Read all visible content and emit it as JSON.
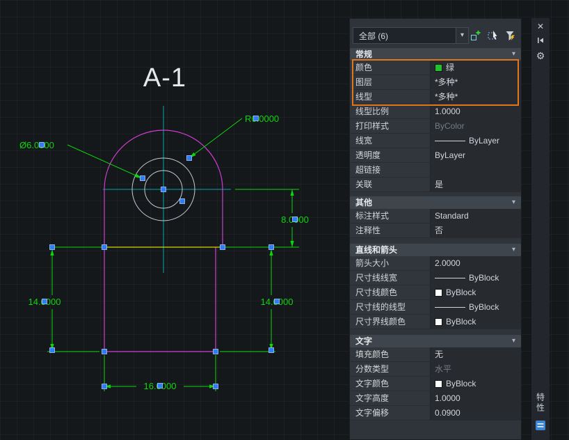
{
  "canvas": {
    "title": "A-1",
    "dimension_texts": {
      "radius": "R6.0000",
      "diameter": "Ø6.0000",
      "height": "8.0000",
      "left_height": "14.0000",
      "right_height": "14.0000",
      "bottom_width": "16.0000"
    },
    "colors": {
      "geometry_magenta": "#cf3ccf",
      "selected_line_yellow": "#d5d500",
      "dimension_green": "#0cd60c",
      "centerline_cyan": "#00a9a9",
      "circle_gray": "#c6cad0",
      "grip_blue": "#2f7df2",
      "highlight_orange": "#e0771d"
    }
  },
  "palette": {
    "selector": {
      "value": "全部 (6)"
    },
    "icons": {
      "dropdown_arrow": "▾",
      "section_chevron": "▾",
      "close": "✕",
      "gear": "⚙"
    },
    "titlebar": {
      "title": "特性"
    },
    "sections": [
      {
        "title": "常规",
        "rows": [
          {
            "label": "颜色",
            "value": "绿",
            "swatch": "#21c32b"
          },
          {
            "label": "图层",
            "value": "*多种*"
          },
          {
            "label": "线型",
            "value": "*多种*"
          },
          {
            "label": "线型比例",
            "value": "1.0000"
          },
          {
            "label": "打印样式",
            "value": "ByColor",
            "muted": true
          },
          {
            "label": "线宽",
            "value": "ByLayer",
            "line_preview": true
          },
          {
            "label": "透明度",
            "value": "ByLayer"
          },
          {
            "label": "超链接",
            "value": ""
          },
          {
            "label": "关联",
            "value": "是"
          }
        ]
      },
      {
        "title": "其他",
        "rows": [
          {
            "label": "标注样式",
            "value": "Standard"
          },
          {
            "label": "注释性",
            "value": "否"
          }
        ]
      },
      {
        "title": "直线和箭头",
        "rows": [
          {
            "label": "箭头大小",
            "value": "2.0000"
          },
          {
            "label": "尺寸线线宽",
            "value": "ByBlock",
            "line_preview": true
          },
          {
            "label": "尺寸线颜色",
            "value": "ByBlock",
            "swatch": "#ffffff"
          },
          {
            "label": "尺寸线的线型",
            "value": "ByBlock",
            "line_preview": true
          },
          {
            "label": "尺寸界线颜色",
            "value": "ByBlock",
            "swatch": "#ffffff"
          }
        ]
      },
      {
        "title": "文字",
        "rows": [
          {
            "label": "填充颜色",
            "value": "无"
          },
          {
            "label": "分数类型",
            "value": "水平",
            "muted": true
          },
          {
            "label": "文字颜色",
            "value": "ByBlock",
            "swatch": "#ffffff"
          },
          {
            "label": "文字高度",
            "value": "1.0000"
          },
          {
            "label": "文字偏移",
            "value": "0.0900"
          }
        ]
      }
    ]
  }
}
